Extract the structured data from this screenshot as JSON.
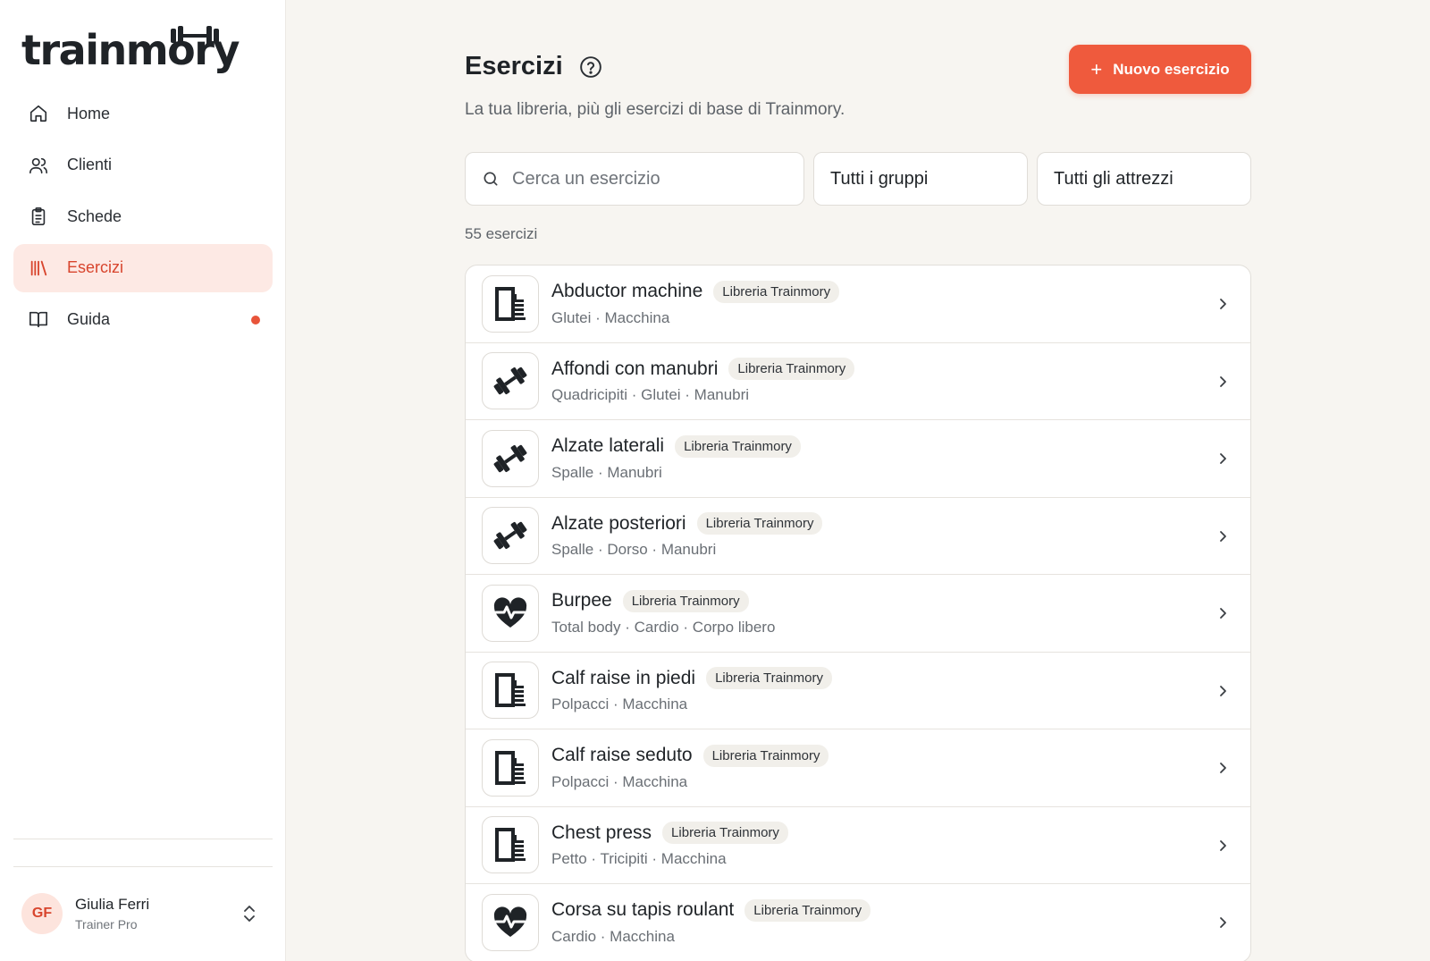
{
  "brand": {
    "logo_text": "trainmory",
    "accent": "#ef5a3d"
  },
  "sidebar": {
    "items": [
      {
        "label": "Home",
        "icon": "home-icon",
        "active": false
      },
      {
        "label": "Clienti",
        "icon": "users-icon",
        "active": false
      },
      {
        "label": "Schede",
        "icon": "clipboard-icon",
        "active": false
      },
      {
        "label": "Esercizi",
        "icon": "library-icon",
        "active": true
      },
      {
        "label": "Guida",
        "icon": "book-icon",
        "active": false,
        "notification": true
      }
    ],
    "user": {
      "initials": "GF",
      "name": "Giulia Ferri",
      "role": "Trainer Pro"
    }
  },
  "header": {
    "title": "Esercizi",
    "subtitle": "La tua libreria, più gli esercizi di base di Trainmory.",
    "new_button_label": "Nuovo esercizio"
  },
  "filters": {
    "search_placeholder": "Cerca un esercizio",
    "group_value": "Tutti i gruppi",
    "equipment_value": "Tutti gli attrezzi"
  },
  "count_label": "55 esercizi",
  "exercises": [
    {
      "name": "Abductor machine",
      "badge": "Libreria Trainmory",
      "meta": "Glutei · Macchina",
      "icon": "machine-icon"
    },
    {
      "name": "Affondi con manubri",
      "badge": "Libreria Trainmory",
      "meta": "Quadricipiti · Glutei · Manubri",
      "icon": "dumbbell-icon"
    },
    {
      "name": "Alzate laterali",
      "badge": "Libreria Trainmory",
      "meta": "Spalle · Manubri",
      "icon": "dumbbell-icon"
    },
    {
      "name": "Alzate posteriori",
      "badge": "Libreria Trainmory",
      "meta": "Spalle · Dorso · Manubri",
      "icon": "dumbbell-icon"
    },
    {
      "name": "Burpee",
      "badge": "Libreria Trainmory",
      "meta": "Total body · Cardio · Corpo libero",
      "icon": "heart-pulse-icon"
    },
    {
      "name": "Calf raise in piedi",
      "badge": "Libreria Trainmory",
      "meta": "Polpacci · Macchina",
      "icon": "machine-icon"
    },
    {
      "name": "Calf raise seduto",
      "badge": "Libreria Trainmory",
      "meta": "Polpacci · Macchina",
      "icon": "machine-icon"
    },
    {
      "name": "Chest press",
      "badge": "Libreria Trainmory",
      "meta": "Petto · Tricipiti · Macchina",
      "icon": "machine-icon"
    },
    {
      "name": "Corsa su tapis roulant",
      "badge": "Libreria Trainmory",
      "meta": "Cardio · Macchina",
      "icon": "heart-pulse-icon"
    }
  ]
}
